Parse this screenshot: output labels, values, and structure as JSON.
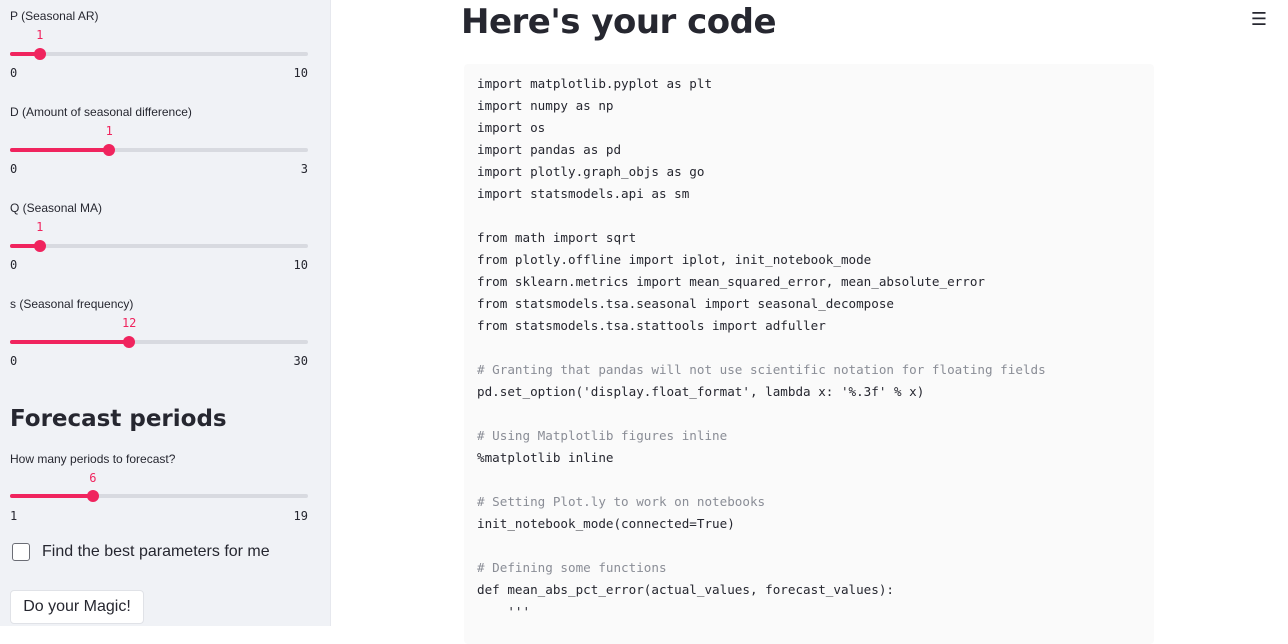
{
  "sidebar": {
    "sliders": [
      {
        "label": "P (Seasonal AR)",
        "value": "1",
        "min": "0",
        "max": "10",
        "fraction": 0.1
      },
      {
        "label": "D (Amount of seasonal difference)",
        "value": "1",
        "min": "0",
        "max": "3",
        "fraction": 0.333
      },
      {
        "label": "Q (Seasonal MA)",
        "value": "1",
        "min": "0",
        "max": "10",
        "fraction": 0.1
      },
      {
        "label": "s (Seasonal frequency)",
        "value": "12",
        "min": "0",
        "max": "30",
        "fraction": 0.4
      }
    ],
    "forecast": {
      "heading": "Forecast periods",
      "slider": {
        "label": "How many periods to forecast?",
        "value": "6",
        "min": "1",
        "max": "19",
        "fraction": 0.2778
      }
    },
    "checkbox_label": "Find the best parameters for me",
    "button_label": "Do your Magic!"
  },
  "main": {
    "title": "Here's your code",
    "menu_icon": "hamburger-menu-icon",
    "code_lines": [
      "import matplotlib.pyplot as plt",
      "import numpy as np",
      "import os",
      "import pandas as pd",
      "import plotly.graph_objs as go",
      "import statsmodels.api as sm",
      "",
      "from math import sqrt",
      "from plotly.offline import iplot, init_notebook_mode",
      "from sklearn.metrics import mean_squared_error, mean_absolute_error",
      "from statsmodels.tsa.seasonal import seasonal_decompose",
      "from statsmodels.tsa.stattools import adfuller",
      "",
      "# Granting that pandas will not use scientific notation for floating fields",
      "pd.set_option('display.float_format', lambda x: '%.3f' % x)",
      "",
      "# Using Matplotlib figures inline",
      "%matplotlib inline",
      "",
      "# Setting Plot.ly to work on notebooks",
      "init_notebook_mode(connected=True)",
      "",
      "# Defining some functions",
      "def mean_abs_pct_error(actual_values, forecast_values):",
      "    '''"
    ]
  },
  "colors": {
    "accent": "#f0245e",
    "sidebar_bg": "#f0f2f6",
    "code_bg": "#fafafa",
    "text": "#262730"
  }
}
